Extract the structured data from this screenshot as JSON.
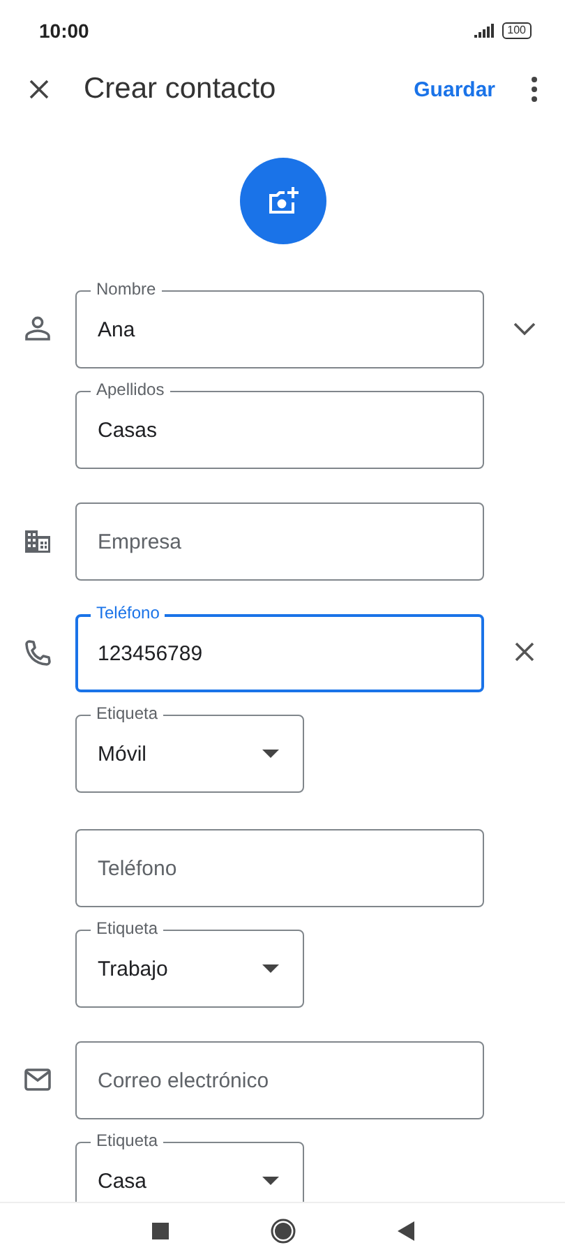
{
  "status_bar": {
    "time": "10:00",
    "battery": "100"
  },
  "app_bar": {
    "title": "Crear contacto",
    "save": "Guardar"
  },
  "sections": [
    {
      "kind": "name",
      "fields": [
        {
          "kind": "text",
          "label": "Nombre",
          "value": "Ana",
          "focused": false
        },
        {
          "kind": "text",
          "label": "Apellidos",
          "value": "Casas",
          "focused": false
        }
      ]
    },
    {
      "kind": "company",
      "fields": [
        {
          "kind": "text",
          "placeholder": "Empresa",
          "focused": false
        }
      ]
    },
    {
      "kind": "phone",
      "fields": [
        {
          "kind": "text",
          "label": "Teléfono",
          "value": "123456789",
          "focused": true
        },
        {
          "kind": "select",
          "label": "Etiqueta",
          "value": "Móvil"
        },
        {
          "kind": "text",
          "placeholder": "Teléfono",
          "focused": false
        },
        {
          "kind": "select",
          "label": "Etiqueta",
          "value": "Trabajo"
        }
      ]
    },
    {
      "kind": "email",
      "fields": [
        {
          "kind": "text",
          "placeholder": "Correo electrónico",
          "focused": false
        },
        {
          "kind": "select",
          "label": "Etiqueta",
          "value": "Casa"
        }
      ]
    }
  ]
}
